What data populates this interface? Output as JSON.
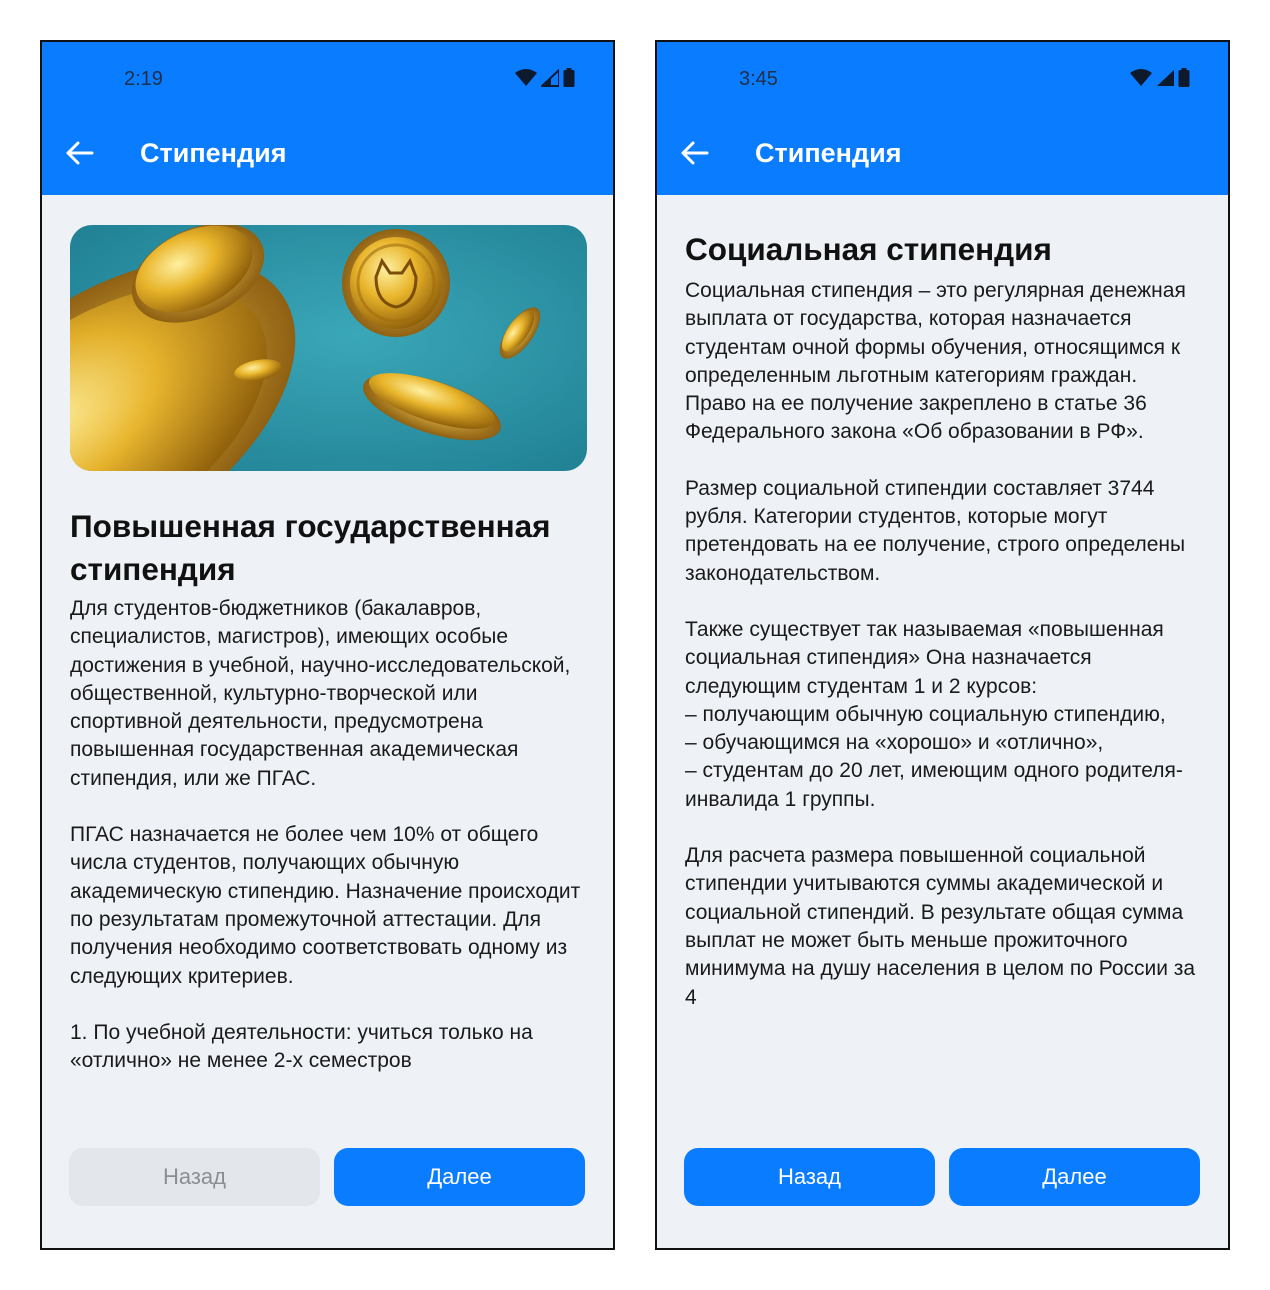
{
  "screens": [
    {
      "status": {
        "time": "2:19",
        "icons": [
          "wifi-icon",
          "signal-icon",
          "battery-icon"
        ]
      },
      "header": {
        "title": "Стипендия",
        "back_icon": "arrow-left-icon"
      },
      "image": {
        "description_icon": "gold-coins-image"
      },
      "heading": "Повышенная государственная стипендия",
      "paragraphs": [
        "Для студентов-бюджетников (бакалавров, специалистов, магистров), имеющих особые достижения в учебной, научно-исследовательской, общественной, культурно-творческой или спортивной деятельности, предусмотрена повышенная государственная академическая стипендия, или же ПГАС.",
        "ПГАС назначается не более чем 10% от общего числа студентов, получающих обычную академическую стипендию. Назначение происходит по результатам промежуточной аттестации. Для получения необходимо соответствовать одному из следующих критериев.",
        "1. По учебной деятельности: учиться только на «отлично» не менее 2-х семестров"
      ],
      "buttons": {
        "prev": "Назад",
        "next": "Далее",
        "prev_enabled": false
      }
    },
    {
      "status": {
        "time": "3:45",
        "icons": [
          "wifi-icon",
          "signal-icon",
          "battery-icon"
        ]
      },
      "header": {
        "title": "Стипендия",
        "back_icon": "arrow-left-icon"
      },
      "heading": "Социальная стипендия",
      "paragraphs": [
        "Социальная стипендия – это регулярная денежная выплата от государства, которая назначается студентам очной формы обучения, относящимся к определенным льготным категориям граждан. Право на ее получение закреплено в статье 36 Федерального закона «Об образовании в РФ».",
        "Размер социальной стипендии составляет 3744 рубля. Категории студентов, которые могут претендовать на ее получение, строго определены законодательством.",
        "Также существует так называемая «повышенная социальная стипендия» Она назначается следующим студентам 1 и 2 курсов:\n– получающим обычную социальную стипендию,\n– обучающимся на «хорошо» и «отлично»,\n– студентам до 20 лет, имеющим одного родителя-инвалида 1 группы.",
        "Для расчета размера повышенной социальной стипендии учитываются суммы академической и социальной стипендий. В результате общая сумма выплат не может быть меньше прожиточного минимума на душу населения в целом по России за 4"
      ],
      "buttons": {
        "prev": "Назад",
        "next": "Далее",
        "prev_enabled": true
      }
    }
  ],
  "colors": {
    "primary": "#0a7cff",
    "background": "#eef2f7",
    "disabled_button": "#e3e6ea",
    "disabled_text": "#8b8f95",
    "banner_teal": "#2f96a8",
    "coin_gold": "#e0a820"
  }
}
